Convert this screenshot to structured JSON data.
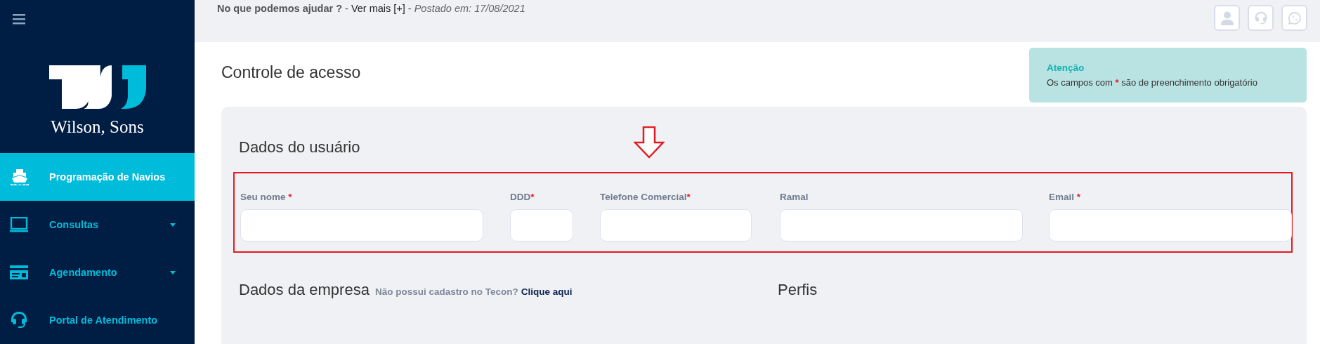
{
  "sidebar": {
    "brand": "Wilson, Sons",
    "items": [
      {
        "kind": "ship",
        "label": "Programação de Navios",
        "selected": true,
        "expandable": false
      },
      {
        "kind": "laptop",
        "label": "Consultas",
        "selected": false,
        "expandable": true
      },
      {
        "kind": "card",
        "label": "Agendamento",
        "selected": false,
        "expandable": true
      },
      {
        "kind": "headset",
        "label": "Portal de Atendimento",
        "selected": false,
        "expandable": false
      }
    ]
  },
  "topbar": {
    "notice": "No que podemos ajudar ?",
    "separator": "-",
    "link": "Ver mais [+]",
    "separator_2": "-",
    "posted": "Postado em: 17/08/2021",
    "buttons": [
      {
        "kind": "user"
      },
      {
        "kind": "headset"
      },
      {
        "kind": "whatsapp"
      }
    ]
  },
  "page": {
    "title": "Controle de acesso"
  },
  "alert": {
    "title": "Atenção",
    "text_before": "Os campos com",
    "mark": "*",
    "text_after": "são de preenchimento obrigatório"
  },
  "user_section": {
    "title": "Dados do usuário",
    "highlighted": true,
    "fields": [
      {
        "label": "Seu nome",
        "required": true
      },
      {
        "label": "DDD",
        "required": true
      },
      {
        "label": "Telefone Comercial",
        "required": true
      },
      {
        "label": "Ramal",
        "required": false
      },
      {
        "label": "Email",
        "required": true
      }
    ]
  },
  "company_section": {
    "title": "Dados da empresa",
    "hint": "Não possui cadastro no Tecon?",
    "link": "Clique aqui"
  },
  "profiles_section": {
    "title": "Perfis"
  }
}
